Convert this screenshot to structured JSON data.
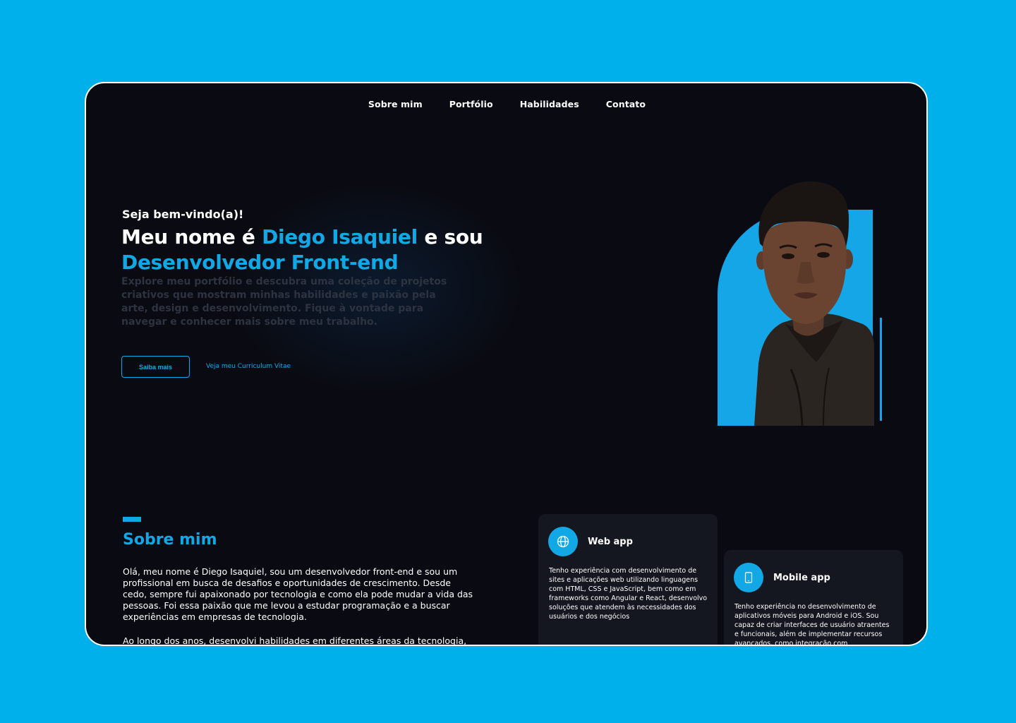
{
  "nav": {
    "items": [
      "Sobre mim",
      "Portfólio",
      "Habilidades",
      "Contato"
    ]
  },
  "hero": {
    "greeting": "Seja bem-vindo(a)!",
    "title_part1": "Meu nome é ",
    "title_name": "Diego Isaquiel",
    "title_part2": " e sou ",
    "title_role": "Desenvolvedor Front-end",
    "intro": "Explore meu portfólio e descubra uma coleção de projetos criativos que mostram minhas habilidades e paixão pela arte, design e desenvolvimento. Fique à vontade para navegar e conhecer mais sobre meu trabalho.",
    "button_label": "Saiba mais",
    "cv_link": "Veja meu Curriculum Vitae"
  },
  "about": {
    "title": "Sobre mim",
    "paragraph1": "Olá, meu nome é Diego Isaquiel, sou um desenvolvedor front-end e sou um profissional em busca de desafios e oportunidades de crescimento. Desde cedo, sempre fui apaixonado por tecnologia e como ela pode mudar a vida das pessoas. Foi essa paixão que me levou a estudar programação e a buscar experiências em empresas de tecnologia.",
    "paragraph2": "Ao longo dos anos, desenvolvi habilidades em diferentes áreas da tecnologia,"
  },
  "cards": [
    {
      "title": "Web app",
      "icon": "globe-icon",
      "text": "Tenho experiência com desenvolvimento de sites e aplicações web utilizando linguagens com HTML, CSS e JavaScript, bem como em frameworks como Angular e React, desenvolvo soluções que atendem às necessidades dos usuários e dos negócios"
    },
    {
      "title": "Mobile app",
      "icon": "smartphone-icon",
      "text": "Tenho experiência no desenvolvimento de aplicativos móveis para Android e iOS. Sou capaz de criar interfaces de usuário atraentes e funcionais, além de implementar recursos avançados, como integração com"
    }
  ],
  "colors": {
    "background": "#00b0eb",
    "panel": "#0a0b12",
    "accent": "#12a8e6",
    "card": "#141620"
  }
}
